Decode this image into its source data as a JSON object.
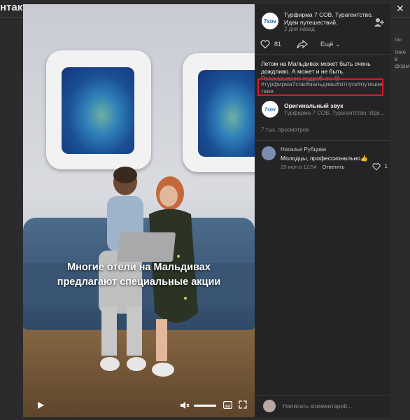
{
  "background": {
    "title": "нтакт",
    "close": "✕",
    "fragments": [
      "пы",
      "ткие",
      "в",
      "форм"
    ]
  },
  "video": {
    "caption_line1": "Многие отели на Мальдивах",
    "caption_line2": "предлагают специальные акции",
    "play_icon": "play-icon",
    "volume_icon": "volume-muted-icon",
    "volume_level": 1.0,
    "subtitles_icon": "subtitles-icon",
    "fullscreen_icon": "fullscreen-icon"
  },
  "post": {
    "avatar_text": "7sov",
    "author": "Турфирма 7 СОВ. Турагентство. Идеи путешествий.",
    "date": "2 дня назад",
    "likes": "81",
    "more_label": "Ещё",
    "description_line1": "Летом на Мальдивах может быть очень",
    "description_line2": "дождливо. А может и не быть.",
    "description_line3": "Рассказываем подробнее 😊",
    "hashtags": "#турфирма7сов#мальдивы#отпуск#путешествие",
    "views": "7 тыс. просмотров"
  },
  "sound": {
    "title": "Оригинальный звук",
    "subtitle": "Турфирма 7 СОВ. Турагентство. Иде..."
  },
  "comment": {
    "name": "Наталья Рубцова",
    "text": "Молодцы, профессионально👍",
    "date": "29 июл в 12:54",
    "reply": "Ответить",
    "likes": "1"
  },
  "compose": {
    "placeholder": "Написать комментарий..."
  }
}
